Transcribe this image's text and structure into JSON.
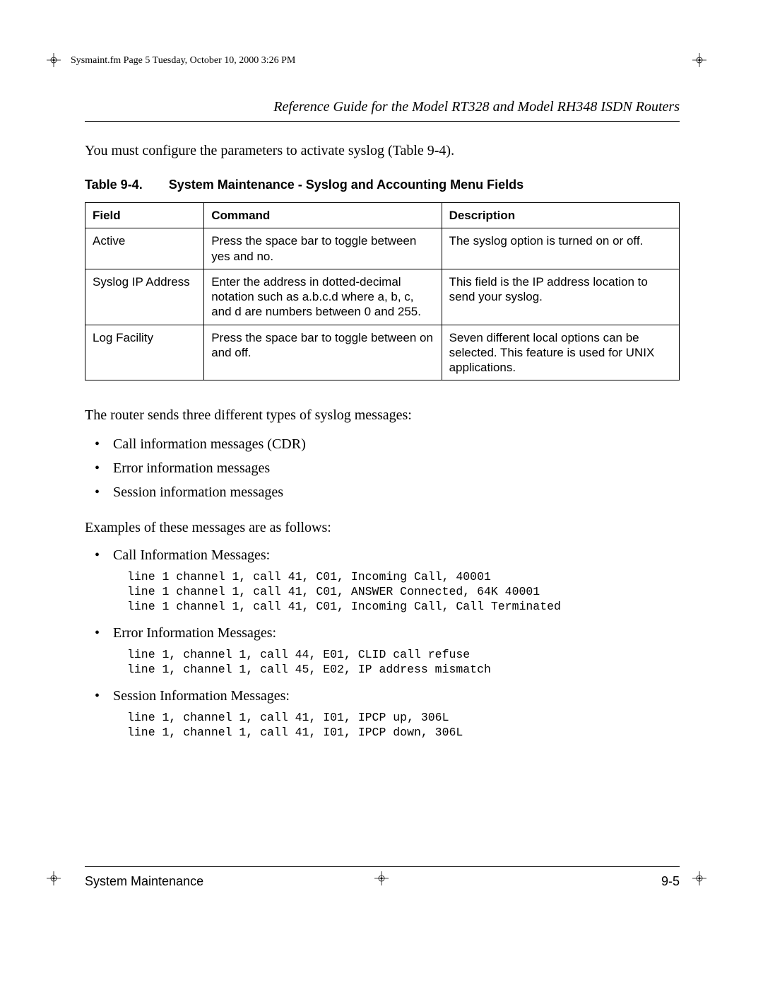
{
  "running_header": "Sysmaint.fm  Page 5  Tuesday, October 10, 2000  3:26 PM",
  "doc_title": "Reference Guide for the Model RT328 and Model RH348 ISDN Routers",
  "intro_para": "You must configure the parameters to activate syslog (Table 9-4).",
  "table_caption_label": "Table 9-4.",
  "table_caption_title": "System Maintenance - Syslog and Accounting Menu Fields",
  "table": {
    "headers": {
      "field": "Field",
      "command": "Command",
      "description": "Description"
    },
    "rows": [
      {
        "field": "Active",
        "command": "Press the space bar to toggle between yes and no.",
        "description": "The syslog option is turned on or off."
      },
      {
        "field": "Syslog IP Address",
        "command": "Enter the address in dotted-decimal notation such as a.b.c.d where a, b, c, and d are numbers between 0 and 255.",
        "description": "This field is the IP address location to send your syslog."
      },
      {
        "field": "Log Facility",
        "command": "Press the space bar to toggle between on and off.",
        "description": "Seven different local options can be selected. This feature is used for UNIX applications."
      }
    ]
  },
  "para_types": "The router sends three different types of syslog messages:",
  "type_bullets": [
    "Call information messages (CDR)",
    "Error information messages",
    "Session information messages"
  ],
  "para_examples": "Examples of these messages are as follows:",
  "examples": [
    {
      "label": "Call Information Messages:",
      "code": "line 1 channel 1, call 41, C01, Incoming Call, 40001\nline 1 channel 1, call 41, C01, ANSWER Connected, 64K 40001\nline 1 channel 1, call 41, C01, Incoming Call, Call Terminated"
    },
    {
      "label": "Error Information Messages:",
      "code": "line 1, channel 1, call 44, E01, CLID call refuse\nline 1, channel 1, call 45, E02, IP address mismatch"
    },
    {
      "label": "Session Information Messages:",
      "code": "line 1, channel 1, call 41, I01, IPCP up, 306L\nline 1, channel 1, call 41, I01, IPCP down, 306L"
    }
  ],
  "footer_left": "System Maintenance",
  "footer_right": "9-5"
}
